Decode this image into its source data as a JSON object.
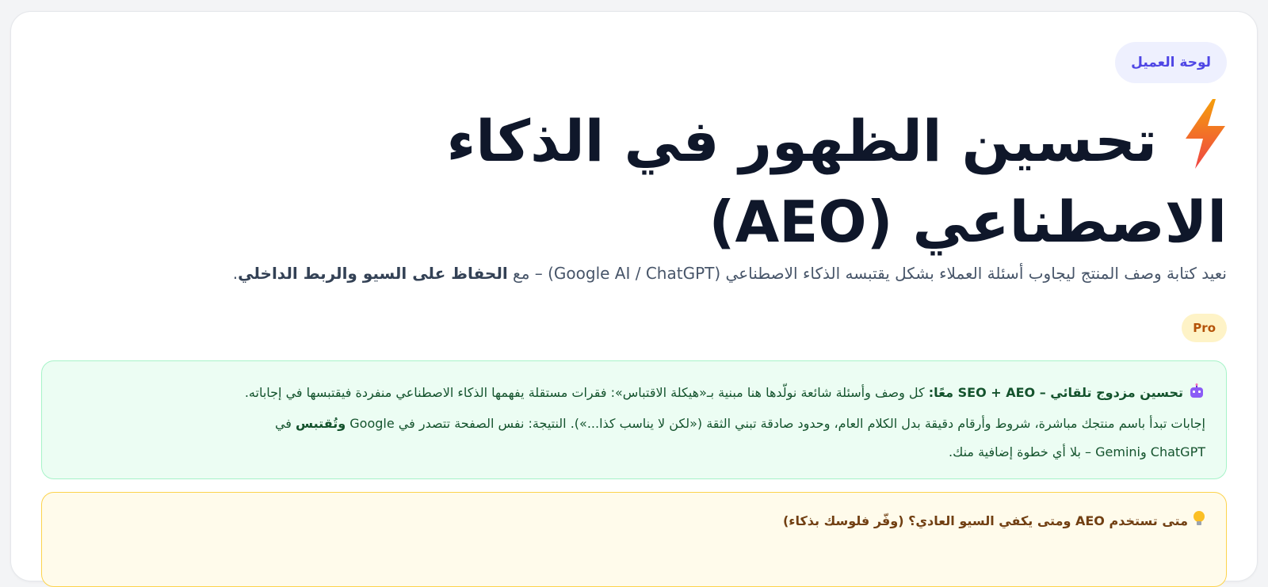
{
  "badge": "لوحة العميل",
  "title": "تحسين الظهور في الذكاء الاصطناعي (AEO)",
  "subtitle": {
    "text": "نعيد كتابة وصف المنتج ليجاوب أسئلة العملاء بشكل يقتبسه الذكاء الاصطناعي (Google AI / ChatGPT) – مع ",
    "bold": "الحفاظ على السيو والربط الداخلي",
    "end": "."
  },
  "plan_badge": "Pro",
  "info_box": {
    "lead": "تحسين مزدوج تلقائي – SEO + AEO معًا:",
    "line1": " كل وصف وأسئلة شائعة نولّدها هنا مبنية بـ«هيكلة الاقتباس»: فقرات مستقلة يفهمها الذكاء الاصطناعي منفردة فيقتبسها في إجاباته.",
    "line2": "إجابات تبدأ باسم منتجك مباشرة، شروط وأرقام دقيقة بدل الكلام العام، وحدود صادقة تبني الثقة («لكن لا يناسب كذا...»). النتيجة: نفس الصفحة تتصدر في Google ",
    "line2_bold": "وتُقتبس",
    "line2_end": " في",
    "line3": "ChatGPT وGemini – بلا أي خطوة إضافية منك."
  },
  "tip_box": {
    "text": "متى تستخدم AEO ومتى يكفي السيو العادي؟ (وفّر فلوسك بذكاء)"
  },
  "colors": {
    "accent": "#4f46e5",
    "title": "#0f172a",
    "success_bg": "#ecfdf3",
    "warning_bg": "#fffbeb"
  }
}
